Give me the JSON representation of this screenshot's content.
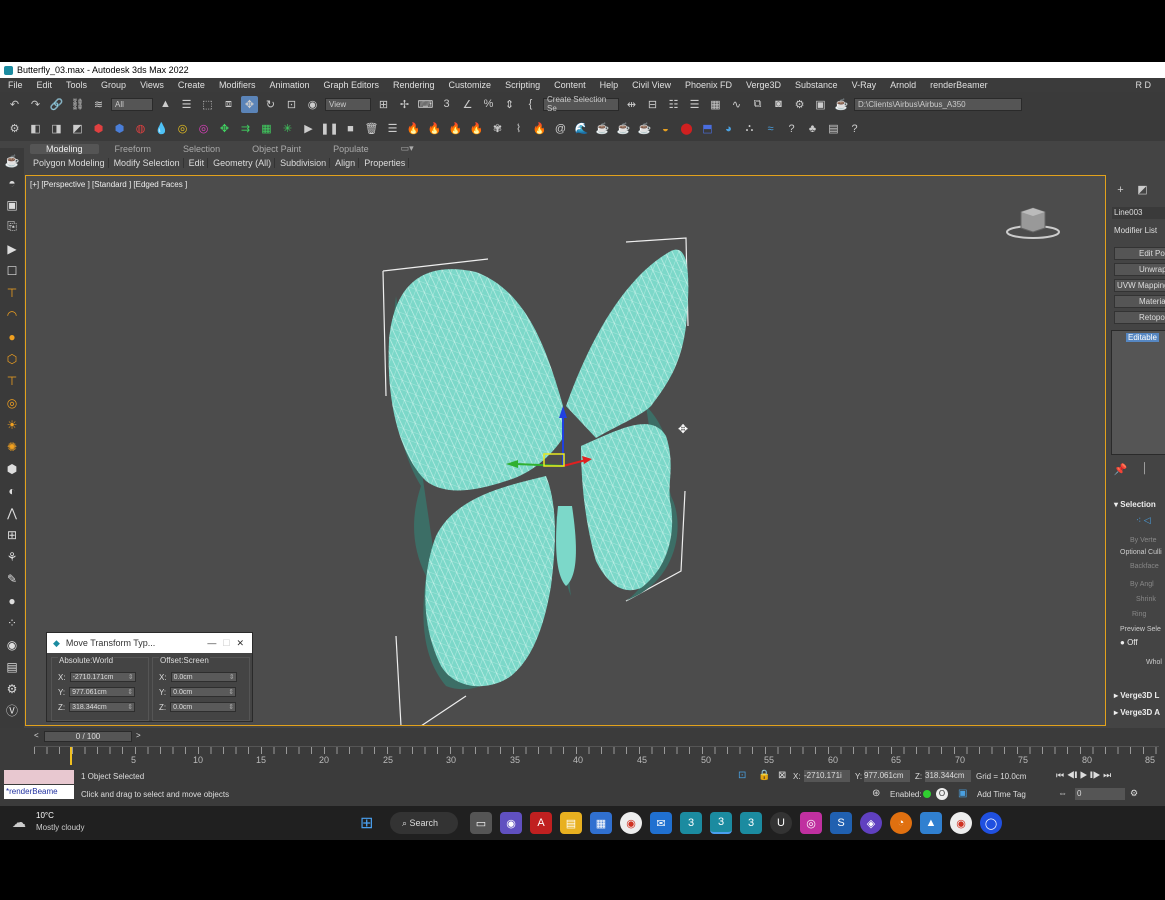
{
  "window": {
    "title": "Butterfly_03.max - Autodesk 3ds Max 2022"
  },
  "menu": [
    "File",
    "Edit",
    "Tools",
    "Group",
    "Views",
    "Create",
    "Modifiers",
    "Animation",
    "Graph Editors",
    "Rendering",
    "Customize",
    "Scripting",
    "Content",
    "Help",
    "Civil View",
    "Phoenix FD",
    "Verge3D",
    "Substance",
    "V-Ray",
    "Arnold",
    "renderBeamer"
  ],
  "menu_right": "R D",
  "toolbar": {
    "selection_filter": "All",
    "ref_coord": "View",
    "named_selection": "Create Selection Se",
    "project_path": "D:\\Clients\\Airbus\\Airbus_A350"
  },
  "ribbon": {
    "tabs": [
      "Modeling",
      "Freeform",
      "Selection",
      "Object Paint",
      "Populate"
    ],
    "subtabs": [
      "Polygon Modeling",
      "Modify Selection",
      "Edit",
      "Geometry (All)",
      "Subdivision",
      "Align",
      "Properties"
    ]
  },
  "viewport": {
    "label": "[+] [Perspective ] [Standard ] [Edged Faces ]",
    "mesh_color": "#7cd8c9"
  },
  "move_dialog": {
    "title": "Move Transform Typ...",
    "absolute_label": "Absolute:World",
    "offset_label": "Offset:Screen",
    "abs": {
      "x": "-2710.171cm",
      "y": "977.061cm",
      "z": "318.344cm"
    },
    "off": {
      "x": "0.0cm",
      "y": "0.0cm",
      "z": "0.0cm"
    }
  },
  "command_panel": {
    "object_name": "Line003",
    "modifier_list": "Modifier List",
    "buttons": [
      "Edit Poly",
      "Unwrap U",
      "UVW Mapping",
      "Material",
      "Retopolog"
    ],
    "stack_item": "Editable",
    "selection_rollout": "Selection",
    "by_vertex": "By Verte",
    "optional_culling": "Optional Culli",
    "backface": "Backface",
    "by_angle": "By Angl",
    "shrink": "Shrink",
    "ring": "Ring",
    "preview_sel": "Preview Sele",
    "off_label": "Off",
    "whole": "Whol",
    "verge1": "Verge3D L",
    "verge2": "Verge3D A"
  },
  "timeline": {
    "slider_label": "0 / 100",
    "ticks": [
      "5",
      "10",
      "15",
      "20",
      "25",
      "30",
      "35",
      "40",
      "45",
      "50",
      "55",
      "60",
      "65",
      "70",
      "75",
      "80",
      "85"
    ]
  },
  "status": {
    "render_tag": "*renderBeame",
    "selected": "1 Object Selected",
    "hint": "Click and drag to select and move objects",
    "x": "-2710.171i",
    "y": "977.061cm",
    "z": "318.344cm",
    "grid": "Grid = 10.0cm",
    "enabled": "Enabled:",
    "add_time_tag": "Add Time Tag",
    "frame": "0"
  },
  "taskbar": {
    "temp": "10°C",
    "weather": "Mostly cloudy",
    "search": "Search"
  }
}
